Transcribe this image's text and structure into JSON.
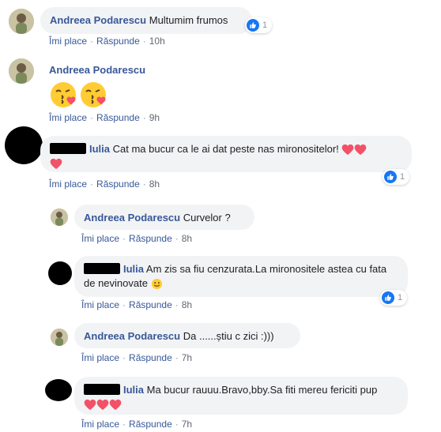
{
  "actions": {
    "like": "Îmi place",
    "reply": "Răspunde",
    "sep": "·"
  },
  "comments": [
    {
      "author": "Andreea Podarescu",
      "text": "Multumim frumos",
      "time": "10h",
      "likes": "1"
    },
    {
      "author": "Andreea Podarescu",
      "text": "",
      "time": "9h",
      "emojis": [
        "kissing-heart-emoji",
        "kissing-heart-emoji"
      ]
    },
    {
      "author": "Iulia",
      "text": "Cat ma bucur ca le ai dat peste nas mironositelor!",
      "time": "8h",
      "likes": "1",
      "hearts": 3
    },
    {
      "author": "Andreea Podarescu",
      "text": "Curvelor ?",
      "time": "8h"
    },
    {
      "author": "Iulia",
      "text": "Am zis sa fiu cenzurata.La mironositele astea cu fata de nevinovate",
      "time": "8h",
      "likes": "1"
    },
    {
      "author": "Andreea Podarescu",
      "text": "Da ......știu c zici :)))",
      "time": "7h"
    },
    {
      "author": "Iulia",
      "text": "Ma bucur rauuu.Bravo,bby.Sa fiti mereu fericiti pup",
      "time": "7h",
      "hearts": 3
    }
  ],
  "colors": {
    "link": "#385898",
    "bubble": "#f2f3f5",
    "like": "#1877f2",
    "heart": "#f25268"
  }
}
